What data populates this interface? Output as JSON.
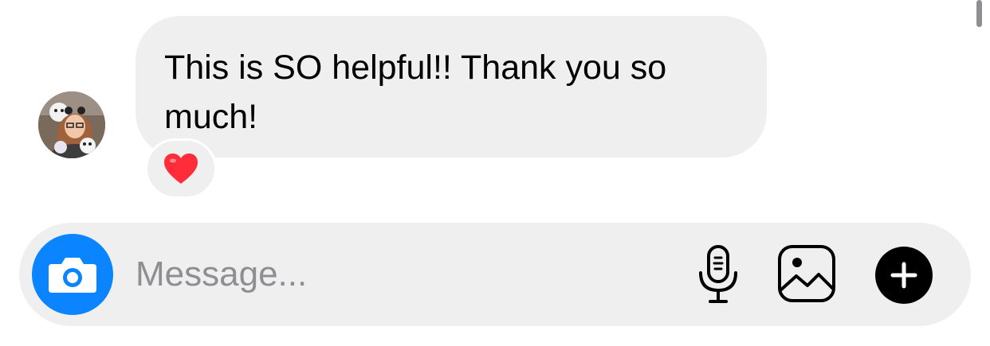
{
  "conversation": {
    "message_text": "This is SO helpful!! Thank you so much!",
    "reaction_emoji": "❤️"
  },
  "composer": {
    "placeholder": "Message...",
    "icons": {
      "camera": "camera-icon",
      "mic": "microphone-icon",
      "gallery": "image-icon",
      "plus": "plus-icon"
    }
  },
  "colors": {
    "bubble_bg": "#efefef",
    "camera_blue": "#0a84ff",
    "placeholder_gray": "#8e8e93",
    "heart_red": "#ff2d3a"
  }
}
